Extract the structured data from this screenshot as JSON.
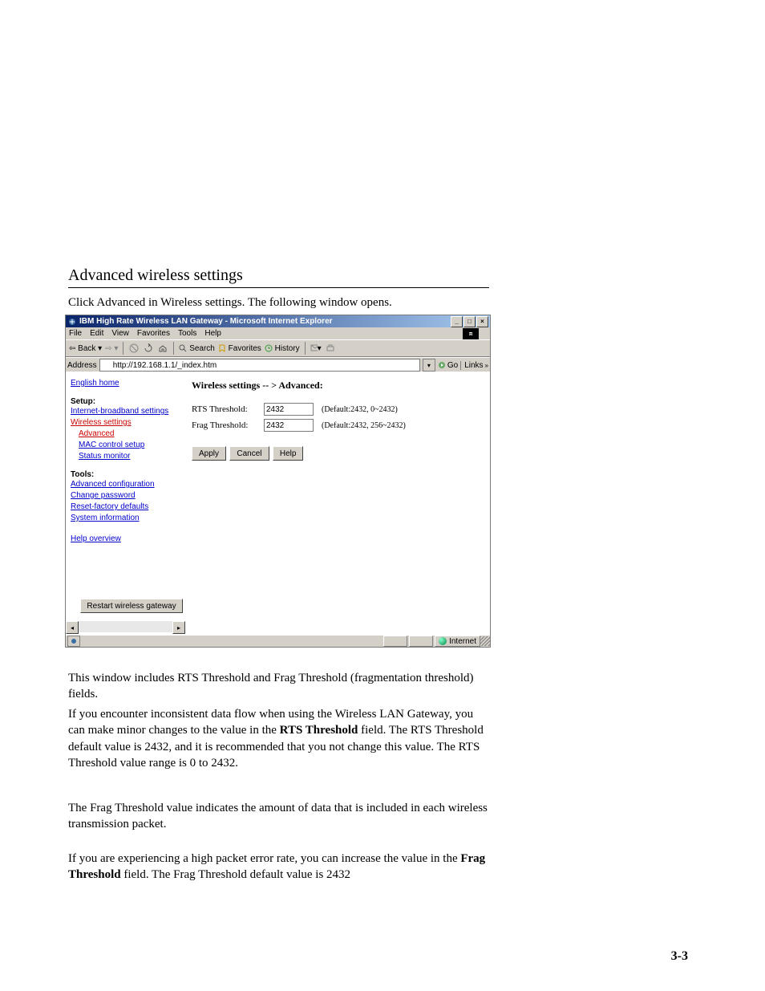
{
  "section_title": "Advanced wireless settings",
  "intro": "Click Advanced in Wireless settings. The following window opens.",
  "window": {
    "title": "IBM High Rate Wireless LAN Gateway - Microsoft Internet Explorer",
    "menus": [
      "File",
      "Edit",
      "View",
      "Favorites",
      "Tools",
      "Help"
    ],
    "toolbar": {
      "back": "Back",
      "search": "Search",
      "favorites": "Favorites",
      "history": "History"
    },
    "address_label": "Address",
    "address_value": "http://192.168.1.1/_index.htm",
    "go": "Go",
    "links": "Links",
    "status_zone": "Internet"
  },
  "sidebar": {
    "home": "English home",
    "setup_hdr": "Setup:",
    "setup": [
      "Internet-broadband settings",
      "Wireless settings",
      "Advanced",
      "MAC control setup",
      "Status monitor"
    ],
    "tools_hdr": "Tools:",
    "tools": [
      "Advanced configuration",
      "Change password",
      "Reset-factory defaults",
      "System information"
    ],
    "help": "Help overview",
    "restart": "Restart wireless gateway"
  },
  "main": {
    "title": "Wireless settings -- > Advanced:",
    "rts_lbl": "RTS Threshold:",
    "rts_val": "2432",
    "rts_hint": "(Default:2432, 0~2432)",
    "frag_lbl": "Frag Threshold:",
    "frag_val": "2432",
    "frag_hint": "(Default:2432, 256~2432)",
    "apply": "Apply",
    "cancel": "Cancel",
    "helpb": "Help"
  },
  "paragraphs": {
    "p1": "This window includes RTS Threshold and Frag Threshold (fragmentation threshold) fields.",
    "p2a": "If you encounter inconsistent data flow when using the Wireless LAN Gateway, you can make minor changes to the value in the ",
    "p2b": "RTS Threshold",
    "p2c": " field. The RTS Threshold default value is ",
    "p2d": "2432",
    "p2e": ", and it is recommended that you not change this value. The RTS Threshold value range is 0 to 2432.",
    "p3": "The Frag Threshold value indicates the amount of data that is included in each wireless transmission packet.",
    "p4a": "If you are experiencing a high packet error rate, you can increase the value in the ",
    "p4b": "Frag Threshold",
    "p4c": " field. The Frag Threshold default value is 2432"
  },
  "pagenum": "3-3"
}
